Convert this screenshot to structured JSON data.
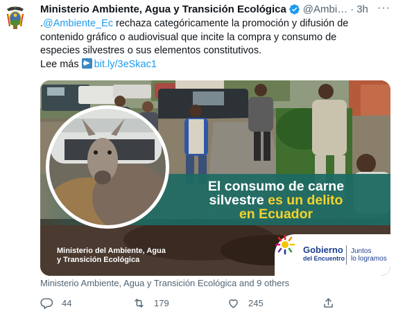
{
  "tweet": {
    "author_name": "Ministerio Ambiente, Agua y Transición Ecológica",
    "handle": "@Ambi…",
    "separator": "·",
    "time": "3h",
    "more_label": "···",
    "body": {
      "line1_prefix": ".",
      "mention": "@Ambiente_Ec",
      "line1_rest": " rechaza categóricamente la promoción y difusión de",
      "line2": "contenido gráfico o audiovisual que incite la compra y consumo de",
      "line3": "especies silvestres o sus elementos constitutivos.",
      "lee_mas": "Lee más",
      "link": "bit.ly/3eSkac1"
    },
    "media": {
      "headline_line1": "El consumo de carne",
      "headline_line2_white": "silvestre",
      "headline_line2_yellow": "es un delito",
      "headline_line3": "en Ecuador",
      "caption_line1": "Ministerio del Ambiente, Agua",
      "caption_line2": "y Transición Ecológica",
      "logo_small": "Gobierno",
      "logo_big": "del Encuentro",
      "tagline_line1": "Juntos",
      "tagline_line2": "lo logramos"
    },
    "tagged": "Ministerio Ambiente, Agua y Transición Ecológica and 9 others",
    "actions": {
      "replies": "44",
      "retweets": "179",
      "likes": "245"
    },
    "colors": {
      "link": "#1d9bf0",
      "verified": "#1d9bf0",
      "muted": "#536471",
      "headline_yellow": "#f6d32c",
      "logo_blue": "#1c3f8f"
    }
  }
}
